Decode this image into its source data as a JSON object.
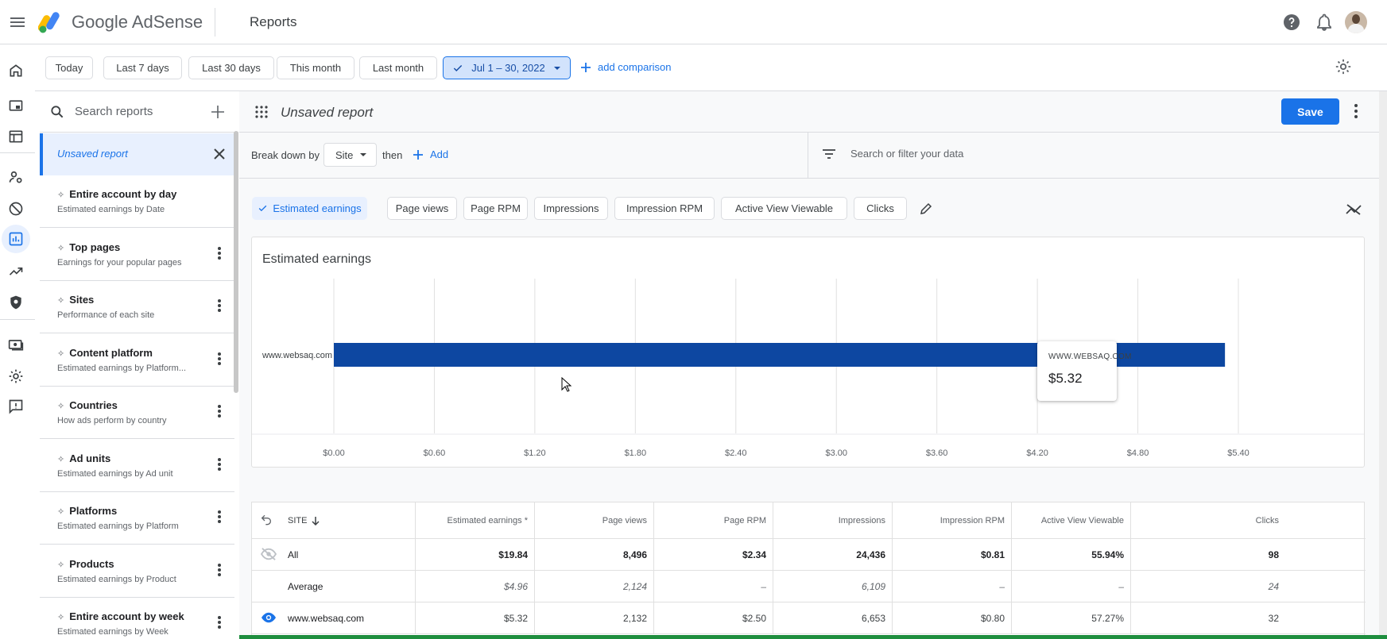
{
  "app": {
    "brand": "Google AdSense",
    "page_title": "Reports"
  },
  "date_chips": [
    {
      "label": "Today"
    },
    {
      "label": "Last 7 days"
    },
    {
      "label": "Last 30 days"
    },
    {
      "label": "This month"
    },
    {
      "label": "Last month"
    },
    {
      "label": "Jul 1 – 30, 2022",
      "selected": true
    }
  ],
  "add_comparison": "add comparison",
  "sidebar": {
    "search_placeholder": "Search reports",
    "unsaved_label": "Unsaved report",
    "reports": [
      {
        "title": "Entire account by day",
        "subtitle": "Estimated earnings by Date"
      },
      {
        "title": "Top pages",
        "subtitle": "Earnings for your popular pages"
      },
      {
        "title": "Sites",
        "subtitle": "Performance of each site"
      },
      {
        "title": "Content platform",
        "subtitle": "Estimated earnings by Platform..."
      },
      {
        "title": "Countries",
        "subtitle": "How ads perform by country"
      },
      {
        "title": "Ad units",
        "subtitle": "Estimated earnings by Ad unit"
      },
      {
        "title": "Platforms",
        "subtitle": "Estimated earnings by Platform"
      },
      {
        "title": "Products",
        "subtitle": "Estimated earnings by Product"
      },
      {
        "title": "Entire account by week",
        "subtitle": "Estimated earnings by Week"
      }
    ]
  },
  "report": {
    "name": "Unsaved report",
    "save_label": "Save",
    "breakdown_label": "Break down by",
    "breakdown_value": "Site",
    "then_label": "then",
    "add_label": "Add",
    "filter_placeholder": "Search or filter your data"
  },
  "metrics": [
    {
      "label": "Estimated earnings",
      "selected": true
    },
    {
      "label": "Page views"
    },
    {
      "label": "Page RPM"
    },
    {
      "label": "Impressions"
    },
    {
      "label": "Impression RPM"
    },
    {
      "label": "Active View Viewable"
    },
    {
      "label": "Clicks"
    }
  ],
  "chart_data": {
    "type": "bar",
    "orientation": "horizontal",
    "title": "Estimated earnings",
    "categories": [
      "www.websaq.com"
    ],
    "values": [
      5.32
    ],
    "xlim": [
      0,
      5.4
    ],
    "x_ticks": [
      "$0.00",
      "$0.60",
      "$1.20",
      "$1.80",
      "$2.40",
      "$3.00",
      "$3.60",
      "$4.20",
      "$4.80",
      "$5.40"
    ],
    "grid": true,
    "bar_color": "#0d47a1",
    "tooltip": {
      "name": "WWW.WEBSAQ.COM",
      "value": "$5.32"
    }
  },
  "table": {
    "site_header": "SITE",
    "headers": [
      "Estimated earnings *",
      "Page views",
      "Page RPM",
      "Impressions",
      "Impression RPM",
      "Active View Viewable",
      "Clicks"
    ],
    "rows": [
      {
        "site": "All",
        "cells": [
          "$19.84",
          "8,496",
          "$2.34",
          "24,436",
          "$0.81",
          "55.94%",
          "98"
        ]
      },
      {
        "site": "Average",
        "cells": [
          "$4.96",
          "2,124",
          "–",
          "6,109",
          "–",
          "–",
          "24"
        ]
      },
      {
        "site": "www.websaq.com",
        "cells": [
          "$5.32",
          "2,132",
          "$2.50",
          "6,653",
          "$0.80",
          "57.27%",
          "32"
        ]
      }
    ]
  },
  "colors": {
    "accent": "#1a73e8",
    "bar": "#0d47a1",
    "selected_bg": "#e8f0fe"
  }
}
